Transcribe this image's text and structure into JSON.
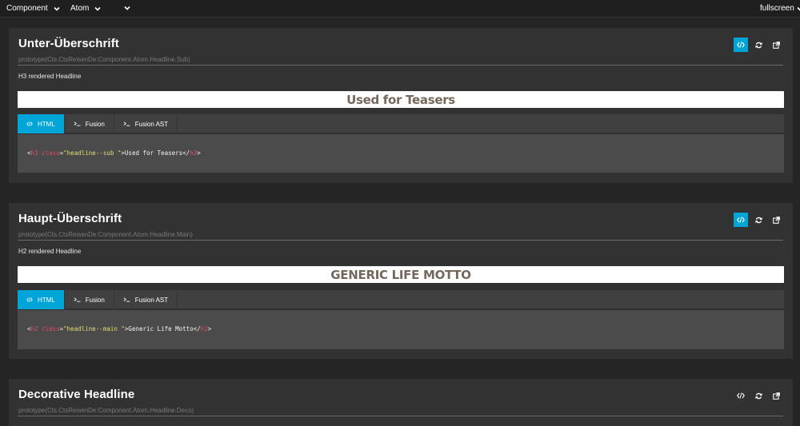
{
  "topbar": {
    "dropdowns": [
      {
        "label": "Component"
      },
      {
        "label": "Atom"
      },
      {
        "label": ""
      }
    ],
    "fullscreen_label": "fullscreen"
  },
  "colors": {
    "accent": "#00a5d8",
    "background": "#252525",
    "card": "#323232",
    "preview_text": "#74685c"
  },
  "cards": [
    {
      "title": "Unter-Überschrift",
      "prototype": "prototype(Cts.CtsReisenDe:Component.Atom.Headline.Sub)",
      "description": "H3 rendered Headline",
      "preview_text": "Used for Teasers",
      "tabs": [
        "HTML",
        "Fusion",
        "Fusion AST"
      ],
      "active_tab": "HTML",
      "code": {
        "open_lt": "<",
        "tag": "h3",
        "attr": "class",
        "eq": "=",
        "value": "\"headline--sub \"",
        "content": ">Used for Teasers</",
        "close_tag": "h3",
        "close_gt": ">"
      },
      "actions": [
        "code-icon",
        "refresh-icon",
        "external-link-icon"
      ]
    },
    {
      "title": "Haupt-Überschrift",
      "prototype": "prototype(Cts.CtsReisenDe:Component.Atom.Headline.Main)",
      "description": "H2 rendered Headline",
      "preview_text": "GENERIC LIFE MOTTO",
      "tabs": [
        "HTML",
        "Fusion",
        "Fusion AST"
      ],
      "active_tab": "HTML",
      "code": {
        "open_lt": "<",
        "tag": "h2",
        "attr": "class",
        "eq": "=",
        "value": "\"headline--main \"",
        "content": ">Generic Life Motto</",
        "close_tag": "h2",
        "close_gt": ">"
      },
      "actions": [
        "code-icon",
        "refresh-icon",
        "external-link-icon"
      ]
    },
    {
      "title": "Decorative Headline",
      "prototype": "prototype(Cts.CtsReisenDe:Component.Atom.Headline.Deco)",
      "actions": [
        "code-icon",
        "refresh-icon",
        "external-link-icon"
      ]
    }
  ]
}
